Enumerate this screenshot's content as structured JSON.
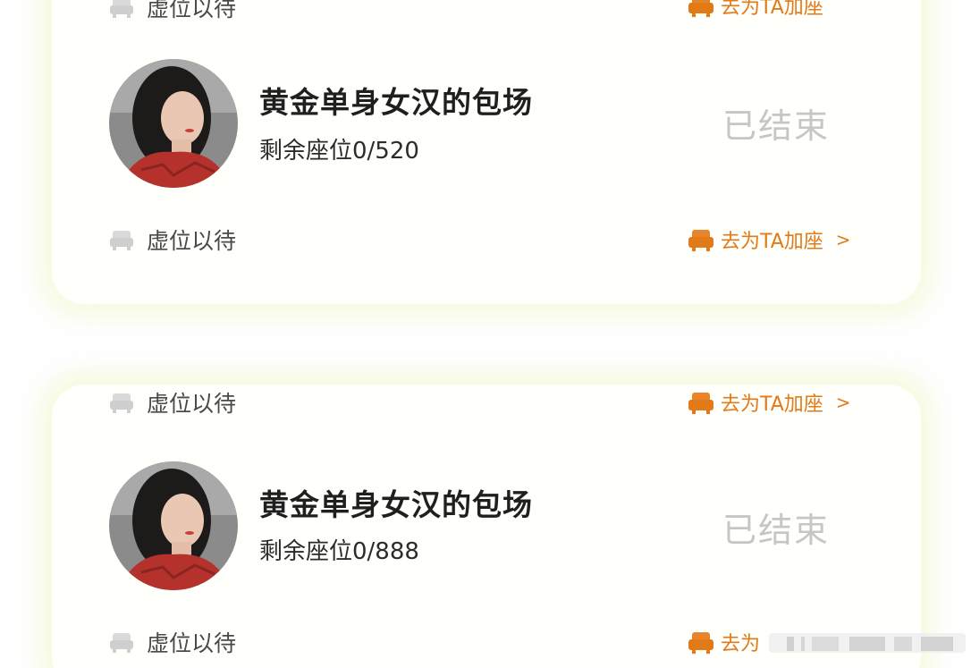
{
  "cards": [
    {
      "top_footer": {
        "left_label": "虚位以待",
        "right_label": "去为TA加座"
      },
      "title": "黄金单身女汉的包场",
      "seats": "剩余座位0/520",
      "status": "已结束",
      "bottom_footer": {
        "left_label": "虚位以待",
        "right_label": "去为TA加座",
        "chevron": ">"
      }
    },
    {
      "top_footer": {
        "left_label": "虚位以待",
        "right_label": "去为TA加座",
        "chevron": ">"
      },
      "title": "黄金单身女汉的包场",
      "seats": "剩余座位0/888",
      "status": "已结束",
      "bottom_footer": {
        "left_label": "虚位以待",
        "right_label": "去为"
      }
    }
  ],
  "colors": {
    "accent": "#e27a17",
    "status_grey": "#c6c6c6",
    "title": "#1f1f1f",
    "card_glow": "#f6f9dc"
  },
  "icons": {
    "seat_empty": "armchair-outline-icon",
    "seat_add": "armchair-filled-icon"
  }
}
